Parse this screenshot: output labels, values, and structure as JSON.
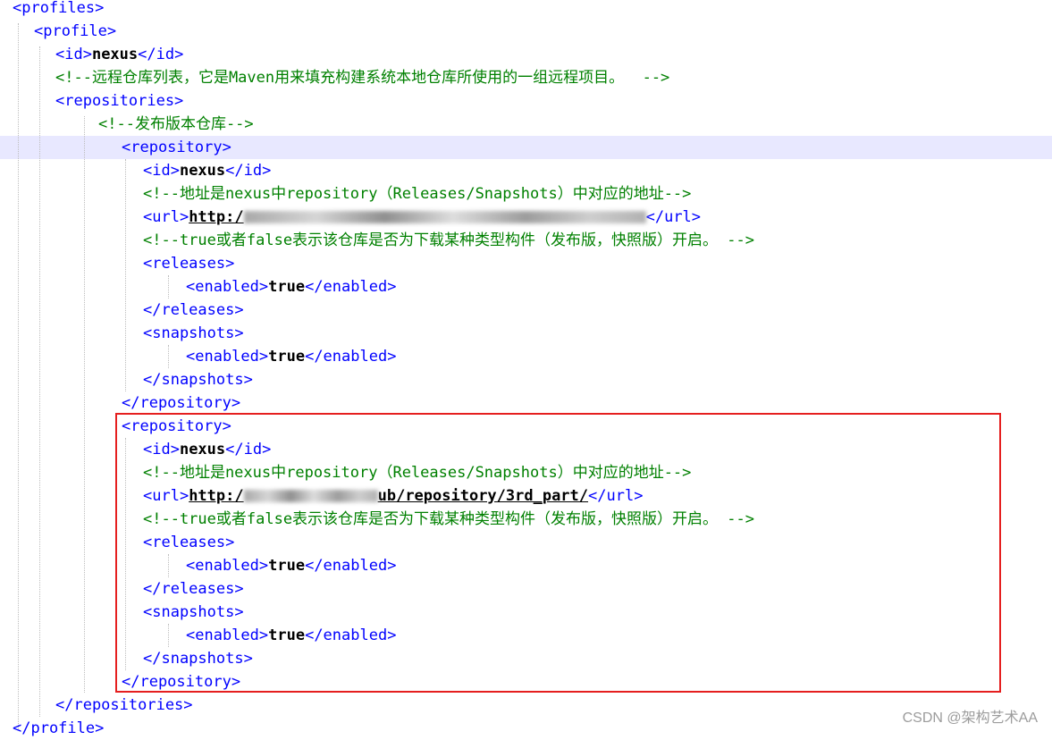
{
  "watermark": "CSDN @架构艺术AA",
  "code": {
    "l1": {
      "open": "<profiles>"
    },
    "l2": {
      "open": "<profile>"
    },
    "l3": {
      "open": "<id>",
      "value": "nexus",
      "close": "</id>"
    },
    "l4": {
      "comment": "<!--远程仓库列表，它是Maven用来填充构建系统本地仓库所使用的一组远程项目。  -->"
    },
    "l5": {
      "open": "<repositories>"
    },
    "l6": {
      "comment": "<!--发布版本仓库-->"
    },
    "r1": {
      "open": "<repository>",
      "id_open": "<id>",
      "id_value": "nexus",
      "id_close": "</id>",
      "comment1": "<!--地址是nexus中repository（Releases/Snapshots）中对应的地址-->",
      "url_open": "<url>",
      "url_prefix": "http:/",
      "url_close": "</url>",
      "comment2": "<!--true或者false表示该仓库是否为下载某种类型构件（发布版，快照版）开启。 -->",
      "releases_open": "<releases>",
      "enabled_open": "<enabled>",
      "enabled_value": "true",
      "enabled_close": "</enabled>",
      "releases_close": "</releases>",
      "snapshots_open": "<snapshots>",
      "enabled2_open": "<enabled>",
      "enabled2_value": "true",
      "enabled2_close": "</enabled>",
      "snapshots_close": "</snapshots>",
      "close": "</repository>"
    },
    "r2": {
      "open": "<repository>",
      "id_open": "<id>",
      "id_value": "nexus",
      "id_close": "</id>",
      "comment1": "<!--地址是nexus中repository（Releases/Snapshots）中对应的地址-->",
      "url_open": "<url>",
      "url_prefix": "http:/",
      "url_suffix": "ub/repository/3rd_part/",
      "url_close": "</url>",
      "comment2": "<!--true或者false表示该仓库是否为下载某种类型构件（发布版，快照版）开启。 -->",
      "releases_open": "<releases>",
      "enabled_open": "<enabled>",
      "enabled_value": "true",
      "enabled_close": "</enabled>",
      "releases_close": "</releases>",
      "snapshots_open": "<snapshots>",
      "enabled2_open": "<enabled>",
      "enabled2_value": "true",
      "enabled2_close": "</enabled>",
      "snapshots_close": "</snapshots>",
      "close": "</repository>"
    },
    "l_end1": {
      "close": "</repositories>"
    },
    "l_end2": {
      "close": "</profile>"
    }
  }
}
